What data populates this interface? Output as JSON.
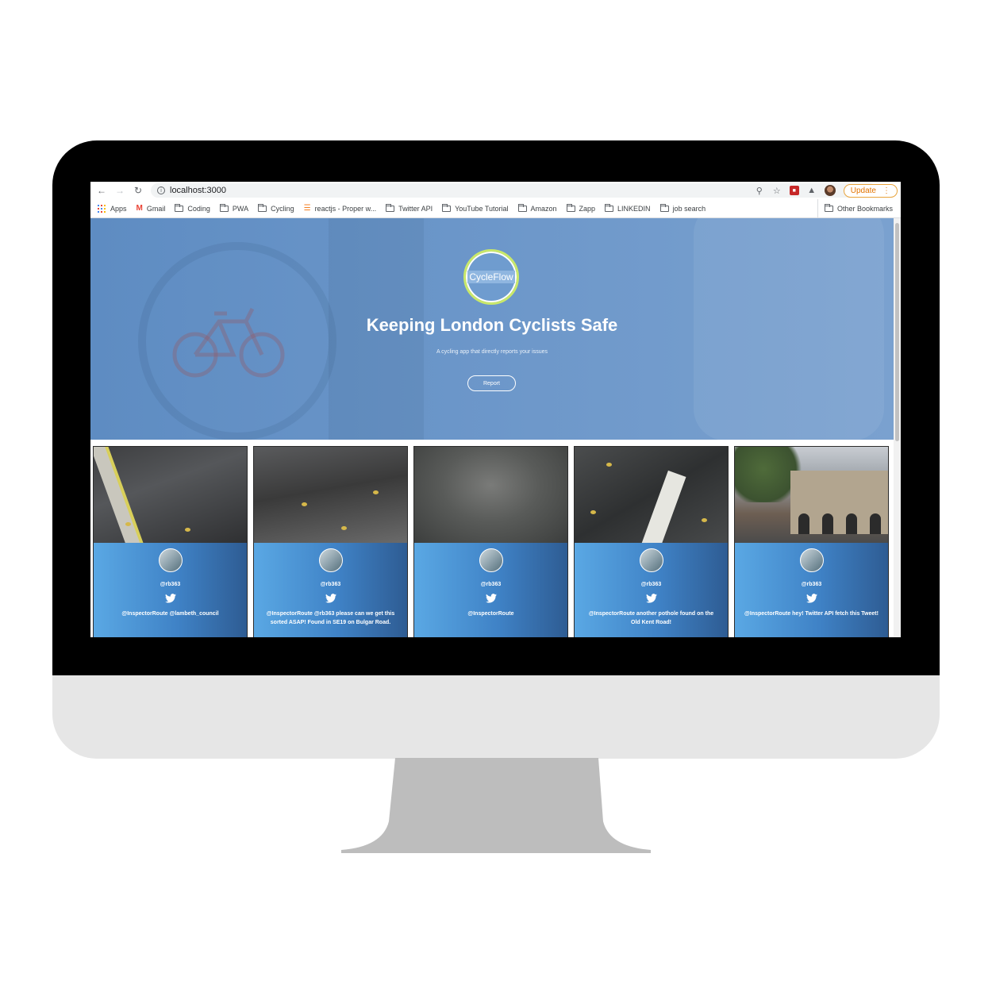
{
  "browser": {
    "url": "localhost:3000",
    "update_label": "Update",
    "bookmarks": [
      {
        "label": "Apps",
        "icon": "apps-icon"
      },
      {
        "label": "Gmail",
        "icon": "gmail-icon"
      },
      {
        "label": "Coding",
        "icon": "folder-icon"
      },
      {
        "label": "PWA",
        "icon": "folder-icon"
      },
      {
        "label": "Cycling",
        "icon": "folder-icon"
      },
      {
        "label": "reactjs - Proper w...",
        "icon": "stackoverflow-icon"
      },
      {
        "label": "Twitter API",
        "icon": "folder-icon"
      },
      {
        "label": "YouTube Tutorial",
        "icon": "folder-icon"
      },
      {
        "label": "Amazon",
        "icon": "folder-icon"
      },
      {
        "label": "Zapp",
        "icon": "folder-icon"
      },
      {
        "label": "LINKEDIN",
        "icon": "folder-icon"
      },
      {
        "label": "job search",
        "icon": "folder-icon"
      }
    ],
    "other_bookmarks": "Other Bookmarks"
  },
  "hero": {
    "logo_text": "CycleFlow",
    "title": "Keeping London Cyclists Safe",
    "subtitle": "A cycling app that directly reports your issues",
    "report_label": "Report"
  },
  "cards": [
    {
      "handle": "@rb363",
      "text": "@InspectorRoute @lambeth_council"
    },
    {
      "handle": "@rb363",
      "text": "@InspectorRoute @rb363 please can we get this sorted ASAP! Found in SE19 on Bulgar Road."
    },
    {
      "handle": "@rb363",
      "text": "@InspectorRoute"
    },
    {
      "handle": "@rb363",
      "text": "@InspectorRoute another pothole found on the Old Kent Road!"
    },
    {
      "handle": "@rb363",
      "text": "@InspectorRoute hey! Twitter API fetch this Tweet!"
    }
  ],
  "colors": {
    "hero": "#6b96c9",
    "logo_ring": "#c9e86a",
    "update_accent": "#e37400"
  }
}
